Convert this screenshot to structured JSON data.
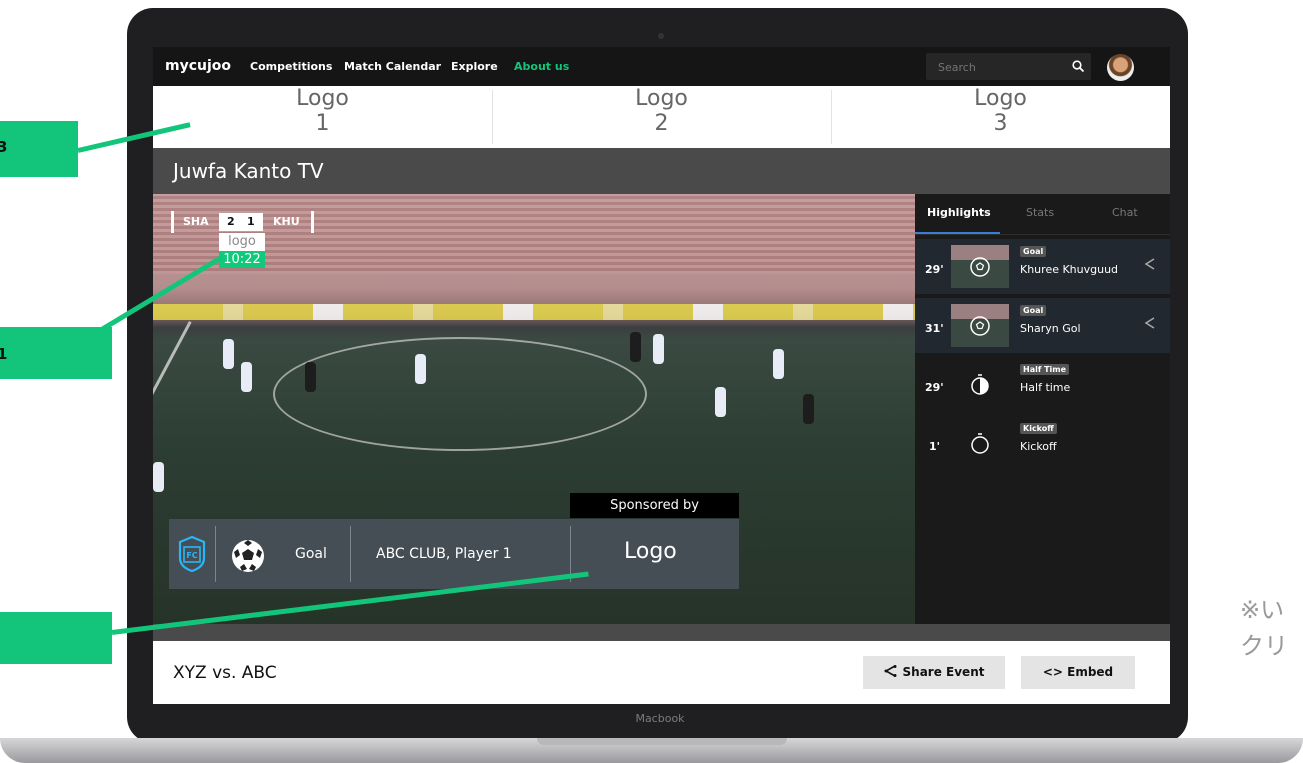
{
  "nav": {
    "brand": "mycujoo",
    "links": [
      "Competitions",
      "Match Calendar",
      "Explore",
      "About us"
    ],
    "search_placeholder": "Search"
  },
  "sponsors": [
    {
      "label": "Logo",
      "number": "1"
    },
    {
      "label": "Logo",
      "number": "2"
    },
    {
      "label": "Logo",
      "number": "3"
    }
  ],
  "channel": {
    "name": "Juwfa Kanto TV"
  },
  "scoreboard": {
    "home": "SHA",
    "home_score": "2",
    "away_score": "1",
    "away": "KHU",
    "logo_text": "logo",
    "clock": "10:22"
  },
  "event_banner": {
    "sponsored_label": "Sponsored by",
    "type": "Goal",
    "player": "ABC CLUB, Player 1",
    "sponsor_logo": "Logo"
  },
  "sidebar": {
    "tabs": [
      "Highlights",
      "Stats",
      "Chat"
    ],
    "active_tab": "Highlights",
    "highlights": [
      {
        "minute": "29'",
        "badge": "Goal",
        "title": "Khuree Khuvguud",
        "icon": "ball-icon"
      },
      {
        "minute": "31'",
        "badge": "Goal",
        "title": "Sharyn Gol",
        "icon": "ball-icon"
      },
      {
        "minute": "29'",
        "badge": "Half Time",
        "title": "Half time",
        "icon": "stopwatch-half-icon"
      },
      {
        "minute": "1'",
        "badge": "Kickoff",
        "title": "Kickoff",
        "icon": "stopwatch-icon"
      }
    ]
  },
  "event": {
    "title": "XYZ vs. ABC",
    "share_label": "Share Event",
    "embed_label": "<> Embed"
  },
  "device_label": "Macbook",
  "annotation_note": "※い\nクリ",
  "colors": {
    "accent": "#12c57a",
    "nav_bg": "#151515",
    "active_tab": "#3d7bd9"
  }
}
